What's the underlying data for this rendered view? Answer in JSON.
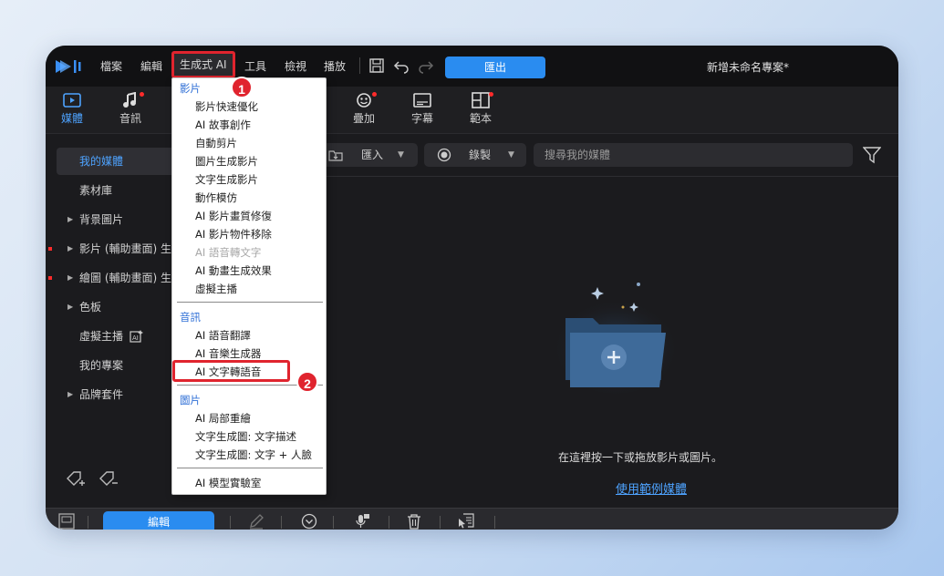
{
  "menubar": {
    "items": [
      "檔案",
      "編輯",
      "生成式 AI",
      "工具",
      "檢視",
      "播放"
    ],
    "export_label": "匯出",
    "project_title": "新增未命名專案*"
  },
  "toolbar": {
    "tools": [
      {
        "label": "媒體",
        "icon": "media-icon"
      },
      {
        "label": "音訊",
        "icon": "music-note-icon"
      },
      {
        "label": "疊加",
        "icon": "sticker-icon"
      },
      {
        "label": "字幕",
        "icon": "subtitle-icon"
      },
      {
        "label": "範本",
        "icon": "template-icon"
      }
    ]
  },
  "sidebar": {
    "items": [
      {
        "label": "我的媒體"
      },
      {
        "label": "素材庫"
      },
      {
        "label": "背景圖片"
      },
      {
        "label": "影片 (輔助畫面) 生"
      },
      {
        "label": "繪圖 (輔助畫面) 生"
      },
      {
        "label": "色板"
      },
      {
        "label": "虛擬主播"
      },
      {
        "label": "我的專案"
      },
      {
        "label": "品牌套件"
      }
    ]
  },
  "main": {
    "import_label": "匯入",
    "record_label": "錄製",
    "search_placeholder": "搜尋我的媒體",
    "empty_text": "在這裡按一下或拖放影片或圖片。",
    "sample_link": "使用範例媒體"
  },
  "bottombar": {
    "edit_label": "編輯"
  },
  "dropdown": {
    "video_header": "影片",
    "video_items": [
      "影片快速優化",
      "AI 故事創作",
      "自動剪片",
      "圖片生成影片",
      "文字生成影片",
      "動作模仿",
      "AI 影片畫質修復",
      "AI 影片物件移除",
      "AI 語音轉文字",
      "AI 動畫生成效果",
      "虛擬主播"
    ],
    "audio_header": "音訊",
    "audio_items": [
      "AI 語音翻譯",
      "AI 音樂生成器",
      "AI 文字轉語音"
    ],
    "image_header": "圖片",
    "image_items": [
      "AI 局部重繪",
      "文字生成圖: 文字描述",
      "文字生成圖: 文字 + 人臉"
    ],
    "lab_item": "AI 模型實驗室"
  },
  "annotations": {
    "badge1": "1",
    "badge2": "2"
  },
  "colors": {
    "accent": "#2a8cf0",
    "highlight": "#e0242e",
    "link": "#4ea3ff"
  }
}
